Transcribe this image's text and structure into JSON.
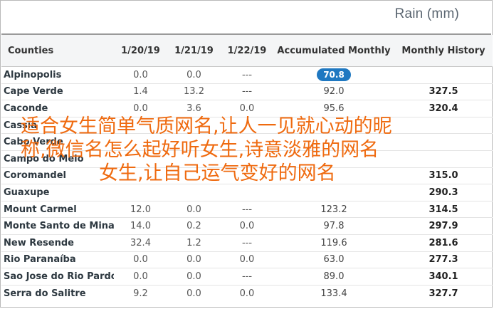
{
  "title": "Rain (mm)",
  "columns": {
    "name": "Counties",
    "d1": "1/20/19",
    "d2": "1/21/19",
    "d3": "1/22/19",
    "acc": "Accumulated Monthly",
    "monthly": "Monthly History"
  },
  "rows": [
    {
      "name": "Alpinopolis",
      "d1": "0.0",
      "d2": "0.0",
      "d3": "---",
      "acc": "70.8",
      "monthly": ""
    },
    {
      "name": "Cape Verde",
      "d1": "1.4",
      "d2": "13.2",
      "d3": "---",
      "acc": "92.0",
      "monthly": "327.5"
    },
    {
      "name": "Caconde",
      "d1": "0.0",
      "d2": "3.6",
      "d3": "0.0",
      "acc": "95.6",
      "monthly": "320.4"
    },
    {
      "name": "Cassia",
      "d1": "",
      "d2": "",
      "d3": "",
      "acc": "",
      "monthly": ""
    },
    {
      "name": "Cabo Verde",
      "d1": "",
      "d2": "",
      "d3": "",
      "acc": "",
      "monthly": ""
    },
    {
      "name": "Campo do Meio",
      "d1": "",
      "d2": "",
      "d3": "",
      "acc": "",
      "monthly": ""
    },
    {
      "name": "Coromandel",
      "d1": "",
      "d2": "",
      "d3": "",
      "acc": "",
      "monthly": "315.0"
    },
    {
      "name": "Guaxupe",
      "d1": "",
      "d2": "",
      "d3": "",
      "acc": "",
      "monthly": "290.3"
    },
    {
      "name": "Mount Carmel",
      "d1": "12.0",
      "d2": "0.0",
      "d3": "---",
      "acc": "123.2",
      "monthly": "314.5"
    },
    {
      "name": "Monte Santo de Minas",
      "d1": "14.0",
      "d2": "0.2",
      "d3": "0.0",
      "acc": "97.8",
      "monthly": "297.9"
    },
    {
      "name": "New Resende",
      "d1": "32.4",
      "d2": "1.2",
      "d3": "---",
      "acc": "119.6",
      "monthly": "281.6"
    },
    {
      "name": "Rio Paranaíba",
      "d1": "0.0",
      "d2": "0.0",
      "d3": "0.0",
      "acc": "63.0",
      "monthly": "277.3"
    },
    {
      "name": "Sao Jose do Rio Pardo",
      "d1": "0.0",
      "d2": "0.0",
      "d3": "---",
      "acc": "89.0",
      "monthly": "340.1"
    },
    {
      "name": "Serra do Salitre",
      "d1": "9.2",
      "d2": "0.0",
      "d3": "0.0",
      "acc": "133.4",
      "monthly": "327.7"
    }
  ],
  "overlay": {
    "line1": "适合女生简单气质网名,让人一见就心动的昵",
    "line2": "称,微信名怎么起好听女生,诗意淡雅的网名",
    "line3": "女生,让自己运气变好的网名"
  },
  "colors": {
    "accent": "#1f78c1",
    "overlay_text": "#ef6a0f"
  }
}
